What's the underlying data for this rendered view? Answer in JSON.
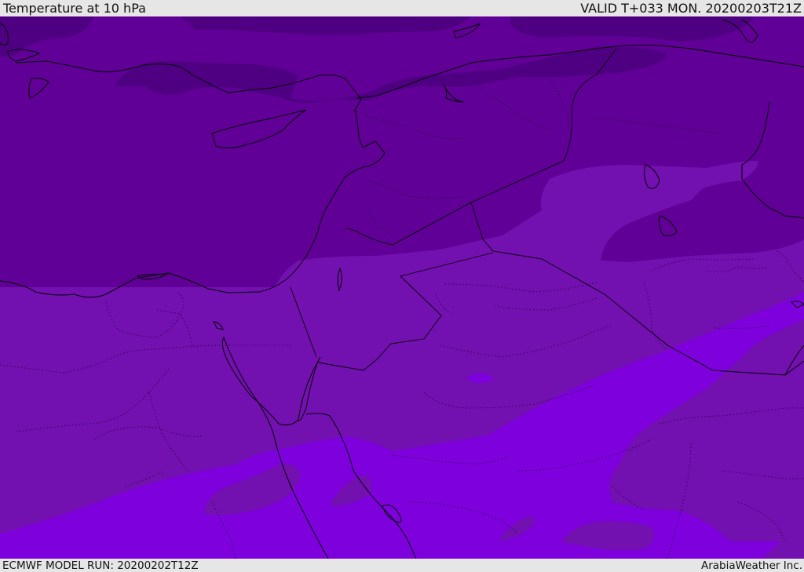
{
  "header": {
    "title": "Temperature at 10 hPa",
    "valid_time": "VALID T+033 MON. 20200203T21Z"
  },
  "footer": {
    "model_run": "ECMWF MODEL RUN: 20200202T12Z",
    "credit": "ArabiaWeather Inc."
  },
  "colors": {
    "band_darkest": "#4f0082",
    "band_dark": "#600096",
    "band_mid": "#7310b0",
    "band_bright": "#7e00dc",
    "coastline": "#000000",
    "bar_background": "#e6e6e6"
  }
}
